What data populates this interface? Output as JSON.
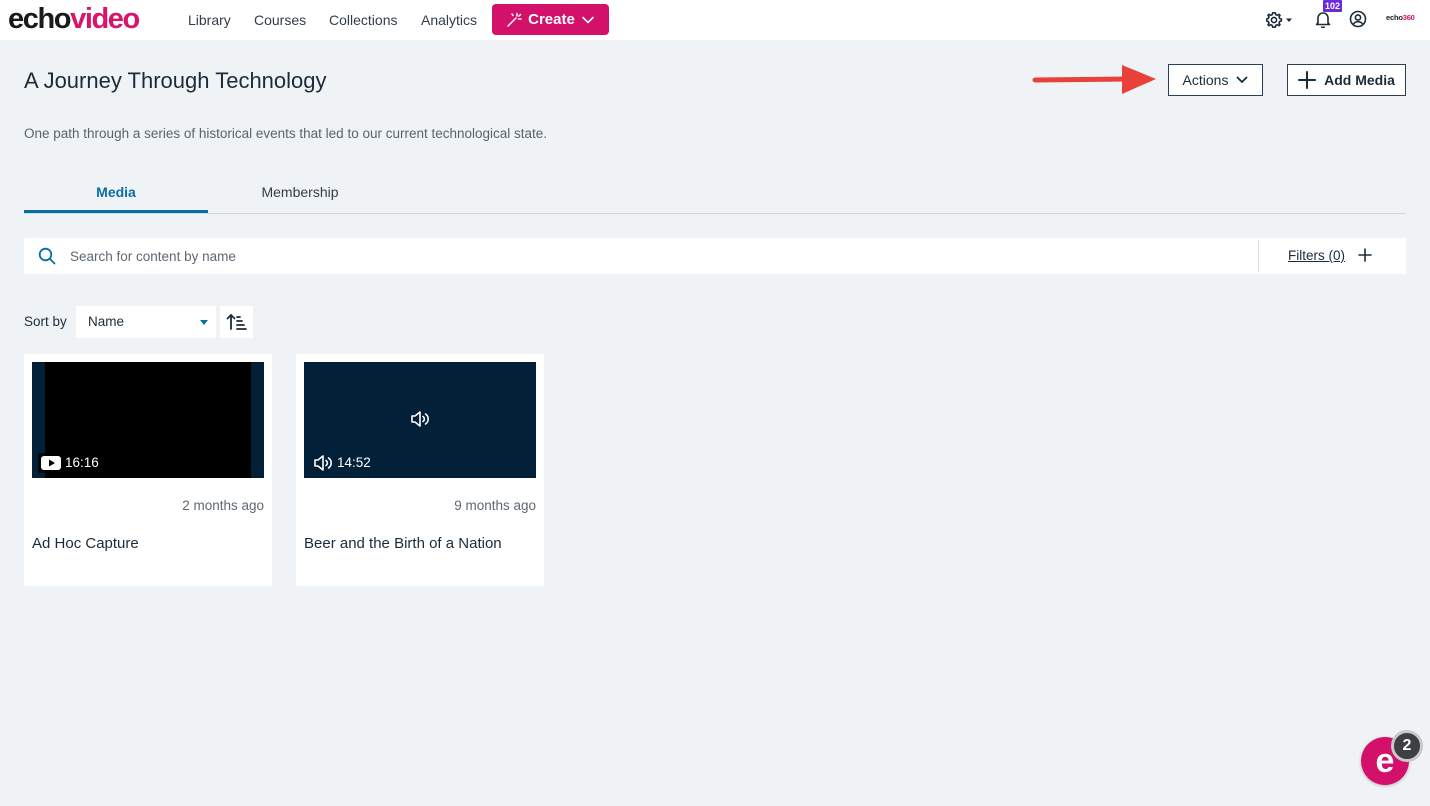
{
  "nav": {
    "logo_echo": "echo",
    "logo_video": "video",
    "links": [
      "Library",
      "Courses",
      "Collections",
      "Analytics"
    ],
    "create_label": "Create",
    "notification_count": "102",
    "brand_mini_prefix": "echo",
    "brand_mini_suffix": "360"
  },
  "header": {
    "title": "A Journey Through Technology",
    "description": "One path through a series of historical events that led to our current technological state.",
    "actions_label": "Actions",
    "add_media_label": "Add Media"
  },
  "tabs": [
    {
      "label": "Media",
      "active": true
    },
    {
      "label": "Membership",
      "active": false
    }
  ],
  "search": {
    "placeholder": "Search for content by name",
    "value": "",
    "filters_label": "Filters (0)"
  },
  "sort": {
    "label": "Sort by",
    "selected": "Name"
  },
  "media": [
    {
      "title": "Ad Hoc Capture",
      "duration": "16:16",
      "age": "2 months ago",
      "kind": "video-icon"
    },
    {
      "title": "Beer and the Birth of a Nation",
      "duration": "14:52",
      "age": "9 months ago",
      "kind": "speaker-icon"
    }
  ],
  "help": {
    "icon_letter": "e",
    "count": "2"
  },
  "colors": {
    "brand_pink": "#d3116a",
    "accent_blue": "#0a6ea4",
    "badge_purple": "#6b2bd9",
    "annotation_red": "#e8413a"
  }
}
